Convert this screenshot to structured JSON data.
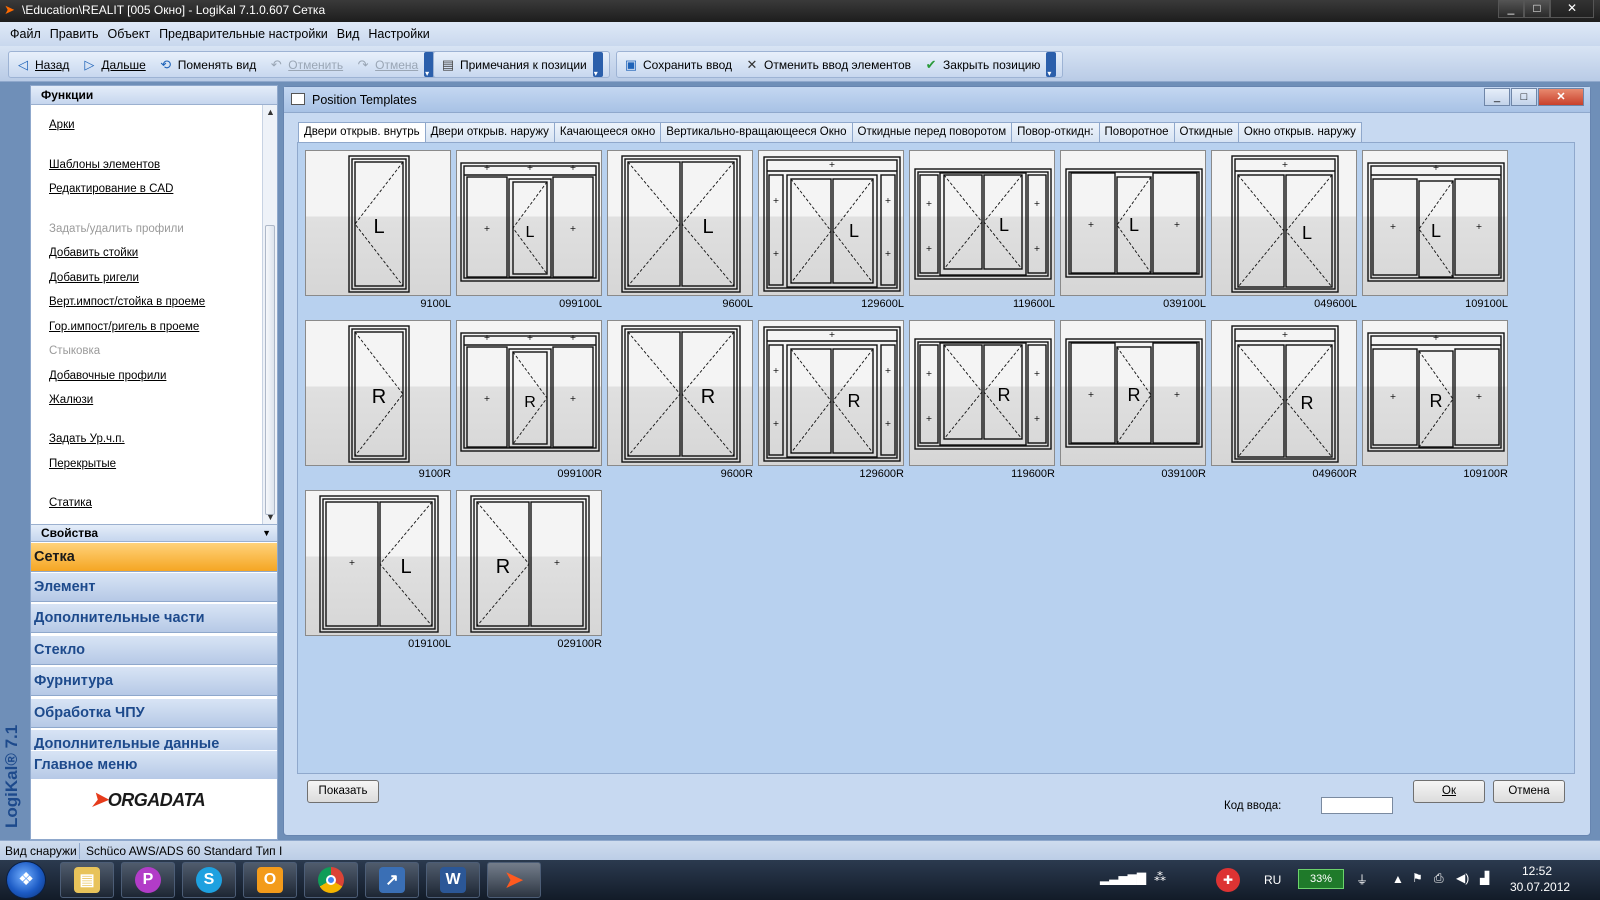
{
  "window": {
    "title": "\\Education\\REALIT [005 Окно] - LogiKal 7.1.0.607 Сетка",
    "controls": [
      "_",
      "□",
      "✕"
    ]
  },
  "menu": [
    "Файл",
    "Править",
    "Объект",
    "Предварительные настройки",
    "Вид",
    "Настройки"
  ],
  "toolbar": {
    "back": "Назад",
    "forward": "Дальше",
    "change_view": "Поменять вид",
    "undo": "Отменить",
    "redo": "Отмена",
    "position_notes": "Примечания к позиции",
    "save_input": "Сохранить ввод",
    "cancel_elements": "Отменить ввод элементов",
    "close_position": "Закрыть позицию"
  },
  "left_panel": {
    "header": "Функции",
    "items": [
      {
        "label": "Арки",
        "disabled": false
      },
      {
        "label": "Шаблоны элементов",
        "disabled": false
      },
      {
        "label": "Редактирование в CAD",
        "disabled": false
      },
      {
        "label": "Задать/удалить профили",
        "disabled": true
      },
      {
        "label": "Добавить стойки",
        "disabled": false
      },
      {
        "label": "Добавить ригели",
        "disabled": false
      },
      {
        "label": "Верт.импост/стойка в проеме",
        "disabled": false
      },
      {
        "label": "Гор.импост/ригель в проеме",
        "disabled": false
      },
      {
        "label": "Стыковка",
        "disabled": true
      },
      {
        "label": "Добавочные профили",
        "disabled": false
      },
      {
        "label": "Жалюзи",
        "disabled": false
      },
      {
        "label": "Задать Ур.ч.п.",
        "disabled": false
      },
      {
        "label": "Перекрытые",
        "disabled": false
      },
      {
        "label": "Статика",
        "disabled": false
      }
    ],
    "properties": "Свойства",
    "nav": [
      "Сетка",
      "Элемент",
      "Дополнительные части",
      "Стекло",
      "Фурнитура",
      "Обработка ЧПУ",
      "Дополнительные данные",
      "Главное меню"
    ],
    "active_nav": "Сетка",
    "logo": "ORGADATA",
    "brand_vertical": "LogiKal® 7.1"
  },
  "dialog": {
    "title": "Position Templates",
    "tabs": [
      "Двери открыв. внутрь",
      "Двери открыв. наружу",
      "Качающееся окно",
      "Вертикально-вращающееся Окно",
      "Откидные перед поворотом",
      "Повор-откидн:",
      "Поворотное",
      "Откидные",
      "Окно открыв. наружу"
    ],
    "active_tab": "Двери открыв. внутрь",
    "templates": [
      {
        "code": "9100L",
        "letter": "L"
      },
      {
        "code": "099100L",
        "letter": "L"
      },
      {
        "code": "9600L",
        "letter": "L"
      },
      {
        "code": "129600L",
        "letter": "L"
      },
      {
        "code": "119600L",
        "letter": "L"
      },
      {
        "code": "039100L",
        "letter": "L"
      },
      {
        "code": "049600L",
        "letter": "L"
      },
      {
        "code": "109100L",
        "letter": "L"
      },
      {
        "code": "9100R",
        "letter": "R"
      },
      {
        "code": "099100R",
        "letter": "R"
      },
      {
        "code": "9600R",
        "letter": "R"
      },
      {
        "code": "129600R",
        "letter": "R"
      },
      {
        "code": "119600R",
        "letter": "R"
      },
      {
        "code": "039100R",
        "letter": "R"
      },
      {
        "code": "049600R",
        "letter": "R"
      },
      {
        "code": "109100R",
        "letter": "R"
      },
      {
        "code": "019100L",
        "letter": "L"
      },
      {
        "code": "029100R",
        "letter": "R"
      }
    ],
    "show_button": "Показать",
    "code_label": "Код ввода:",
    "code_value": "",
    "ok_button": "Ок",
    "cancel_button": "Отмена"
  },
  "statusbar": {
    "view": "Вид снаружи",
    "system": "Schüco AWS/ADS 60 Standard Тип I"
  },
  "taskbar": {
    "language": "RU",
    "battery": "33%",
    "time": "12:52",
    "date": "30.07.2012",
    "apps": [
      "explorer-icon",
      "p-app-icon",
      "skype-icon",
      "outlook-icon",
      "chrome-icon",
      "app-icon",
      "word-icon",
      "logikal-icon"
    ]
  },
  "colors": {
    "accent_orange": "#f5a623",
    "nav_text": "#1d4a8c",
    "dialog_bg": "#c7d9f1",
    "canvas_bg": "#b8d1ef"
  }
}
